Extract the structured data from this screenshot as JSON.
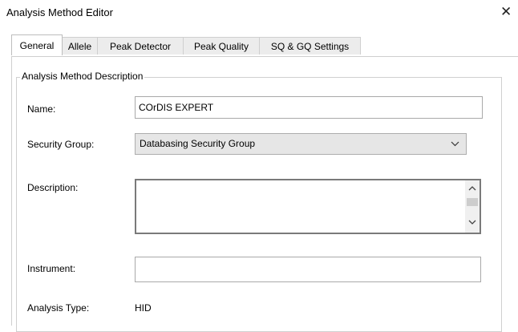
{
  "window": {
    "title": "Analysis Method Editor",
    "close_glyph": "✕"
  },
  "tabs": [
    {
      "label": "General",
      "active": true
    },
    {
      "label": "Allele",
      "active": false
    },
    {
      "label": "Peak Detector",
      "active": false
    },
    {
      "label": "Peak Quality",
      "active": false
    },
    {
      "label": "SQ & GQ Settings",
      "active": false
    }
  ],
  "group": {
    "legend": "Analysis Method Description",
    "name_label": "Name:",
    "name_value": "COrDIS EXPERT",
    "security_label": "Security Group:",
    "security_value": "Databasing Security Group",
    "description_label": "Description:",
    "description_value": "",
    "instrument_label": "Instrument:",
    "instrument_value": "",
    "analysis_type_label": "Analysis Type:",
    "analysis_type_value": "HID"
  },
  "icons": {
    "close": "close-icon",
    "dropdown": "chevron-down-icon",
    "scroll_up": "scroll-up-icon",
    "scroll_down": "scroll-down-icon"
  }
}
